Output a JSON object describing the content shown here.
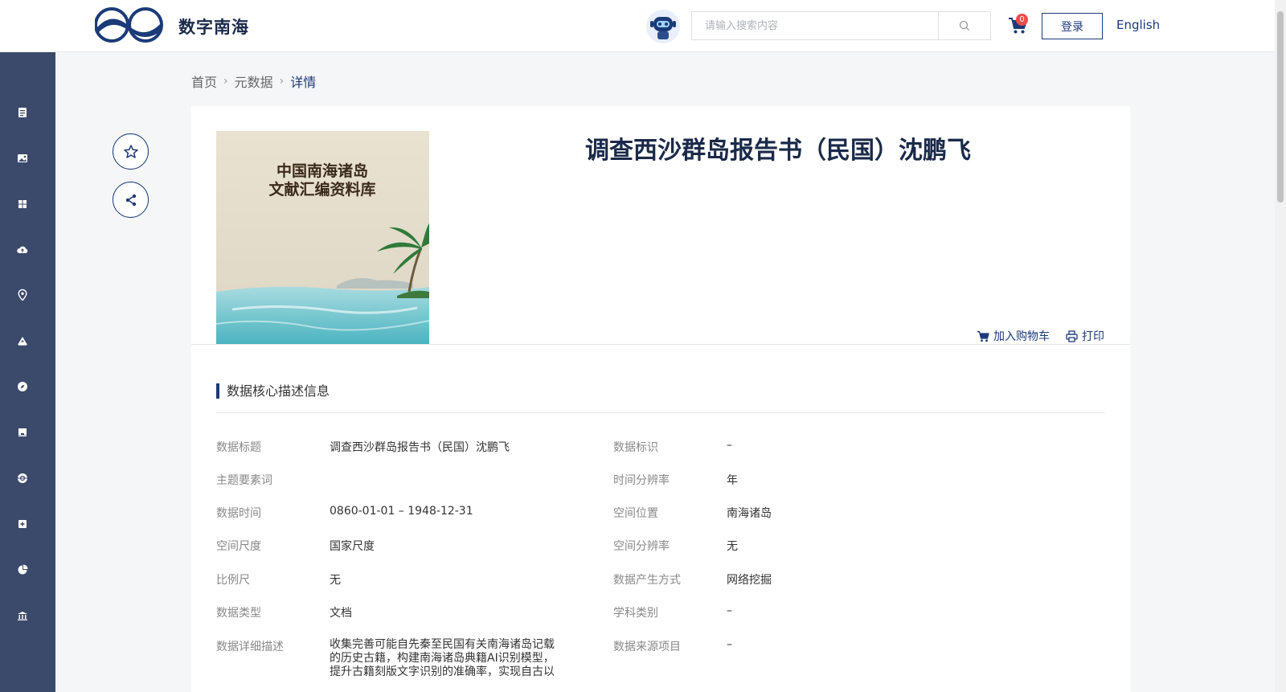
{
  "header": {
    "site_name": "数字南海",
    "search_placeholder": "请输入搜索内容",
    "cart_count": "0",
    "login_label": "登录",
    "lang_label": "English"
  },
  "sidebar": {
    "items": [
      "document-icon",
      "image-icon",
      "grid-icon",
      "cloud-icon",
      "location-icon",
      "terrain-icon",
      "compass-icon",
      "store-icon",
      "globe-icon",
      "plus-box-icon",
      "pie-chart-icon",
      "library-icon"
    ]
  },
  "breadcrumb": {
    "items": [
      "首页",
      "元数据",
      "详情"
    ]
  },
  "detail": {
    "title": "调查西沙群岛报告书（民国）沈鹏飞",
    "cover_text_line1": "中国南海诸岛",
    "cover_text_line2": "文献汇编资料库",
    "add_cart": "加入购物车",
    "print": "打印"
  },
  "section": {
    "title": "数据核心描述信息"
  },
  "fields_left": [
    {
      "label": "数据标题",
      "value": "调查西沙群岛报告书（民国）沈鹏飞"
    },
    {
      "label": "主题要素词",
      "value": ""
    },
    {
      "label": "数据时间",
      "value": "0860-01-01 – 1948-12-31"
    },
    {
      "label": "空间尺度",
      "value": "国家尺度"
    },
    {
      "label": "比例尺",
      "value": "无"
    },
    {
      "label": "数据类型",
      "value": "文档"
    },
    {
      "label": "数据详细描述",
      "value": "收集完善可能自先秦至民国有关南海诸岛记载的历史古籍，构建南海诸岛典籍AI识别模型，提升古籍刻版文字识别的准确率，实现自古以"
    }
  ],
  "fields_right": [
    {
      "label": "数据标识",
      "value": "–"
    },
    {
      "label": "时间分辨率",
      "value": "年"
    },
    {
      "label": "空间位置",
      "value": "南海诸岛"
    },
    {
      "label": "空间分辨率",
      "value": "无"
    },
    {
      "label": "数据产生方式",
      "value": "网络挖掘"
    },
    {
      "label": "学科类别",
      "value": "–"
    },
    {
      "label": "数据来源项目",
      "value": "–"
    }
  ],
  "colors": {
    "primary": "#1b3a78",
    "sidebar": "#3b4a6b",
    "badge": "#f04a4a"
  }
}
